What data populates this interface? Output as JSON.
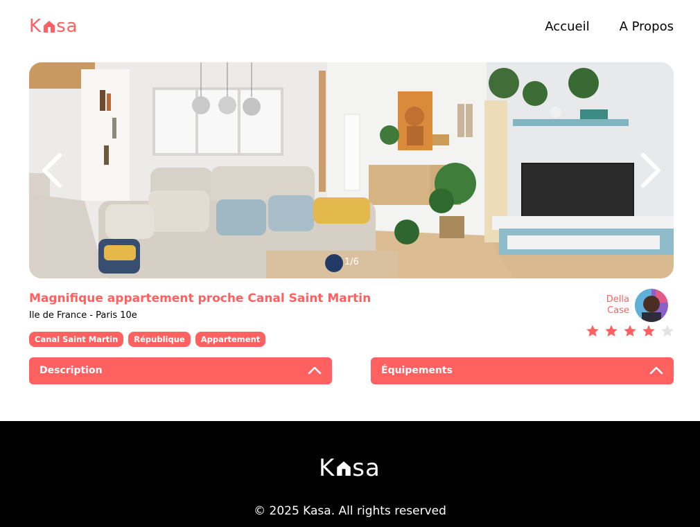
{
  "brand": {
    "name_part1": "K",
    "name_part2": "sa",
    "color": "#FF6060"
  },
  "nav": {
    "home": "Accueil",
    "about": "A Propos"
  },
  "gallery": {
    "counter": "1/6",
    "prev_icon": "chevron-left-icon",
    "next_icon": "chevron-right-icon"
  },
  "listing": {
    "title": "Magnifique appartement proche Canal Saint Martin",
    "location": "Ile de France - Paris 10e",
    "tags": [
      "Canal Saint Martin",
      "République",
      "Appartement"
    ]
  },
  "host": {
    "first_name": "Della",
    "last_name": "Case"
  },
  "rating": {
    "value": 4,
    "max": 5,
    "active_color": "#FF6060",
    "inactive_color": "#E3E3E3"
  },
  "sections": {
    "description": "Description",
    "equipments": "Équipements"
  },
  "footer": {
    "copyright": "© 2025 Kasa. All rights reserved"
  }
}
